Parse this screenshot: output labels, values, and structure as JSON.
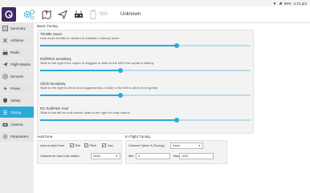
{
  "status_bar": {
    "wifi": "▼",
    "signal": "◢",
    "battery": "99%",
    "time": "1:21 pm"
  },
  "toolbar": {
    "link_text": "N/A",
    "mode": "Unknown"
  },
  "sidebar": {
    "items": [
      {
        "label": "Summary",
        "icon": "summary-icon"
      },
      {
        "label": "Airframe",
        "icon": "airframe-icon"
      },
      {
        "label": "Radio",
        "icon": "radio-icon"
      },
      {
        "label": "Flight Modes",
        "icon": "flight-modes-icon"
      },
      {
        "label": "Sensors",
        "icon": "sensors-icon"
      },
      {
        "label": "Power",
        "icon": "power-icon"
      },
      {
        "label": "Safety",
        "icon": "safety-icon"
      },
      {
        "label": "Tuning",
        "icon": "tuning-icon",
        "active": true
      },
      {
        "label": "Camera",
        "icon": "camera-icon"
      },
      {
        "label": "Parameters",
        "icon": "parameters-icon"
      }
    ]
  },
  "basic_tuning": {
    "title": "Basic Tuning",
    "settings": [
      {
        "title": "Throttle Hover",
        "desc": "How much throttle is needed to maintain a steady hover",
        "value": 0.65
      },
      {
        "title": "Roll/Pitch Sensitivity",
        "desc": "Slide to the right if the copter is sluggish or slide to the left if the copter is twitchy",
        "value": 0.38
      },
      {
        "title": "Climb Sensitivity",
        "desc": "Slide to the right to climb more aggressively or slide to the left to climb more gently",
        "value": 0.38
      },
      {
        "title": "RC Roll/Pitch Feel",
        "desc": "Slide to the left for soft control, slide to the right for crisp control",
        "value": 0.65
      }
    ]
  },
  "autotune": {
    "title": "AutoTune",
    "axes_label": "Axes to AutoTune:",
    "roll": "Roll",
    "pitch": "Pitch",
    "yaw": "Yaw",
    "switch_label": "Channel for AutoTune switch:",
    "switch_value": "None"
  },
  "inflight": {
    "title": "In Flight Tuning",
    "channel_label": "Channel Option 6 (Tuning):",
    "channel_value": "None",
    "min_label": "Min:",
    "min_value": "0",
    "max_label": "Max:",
    "max_value": "1000"
  }
}
